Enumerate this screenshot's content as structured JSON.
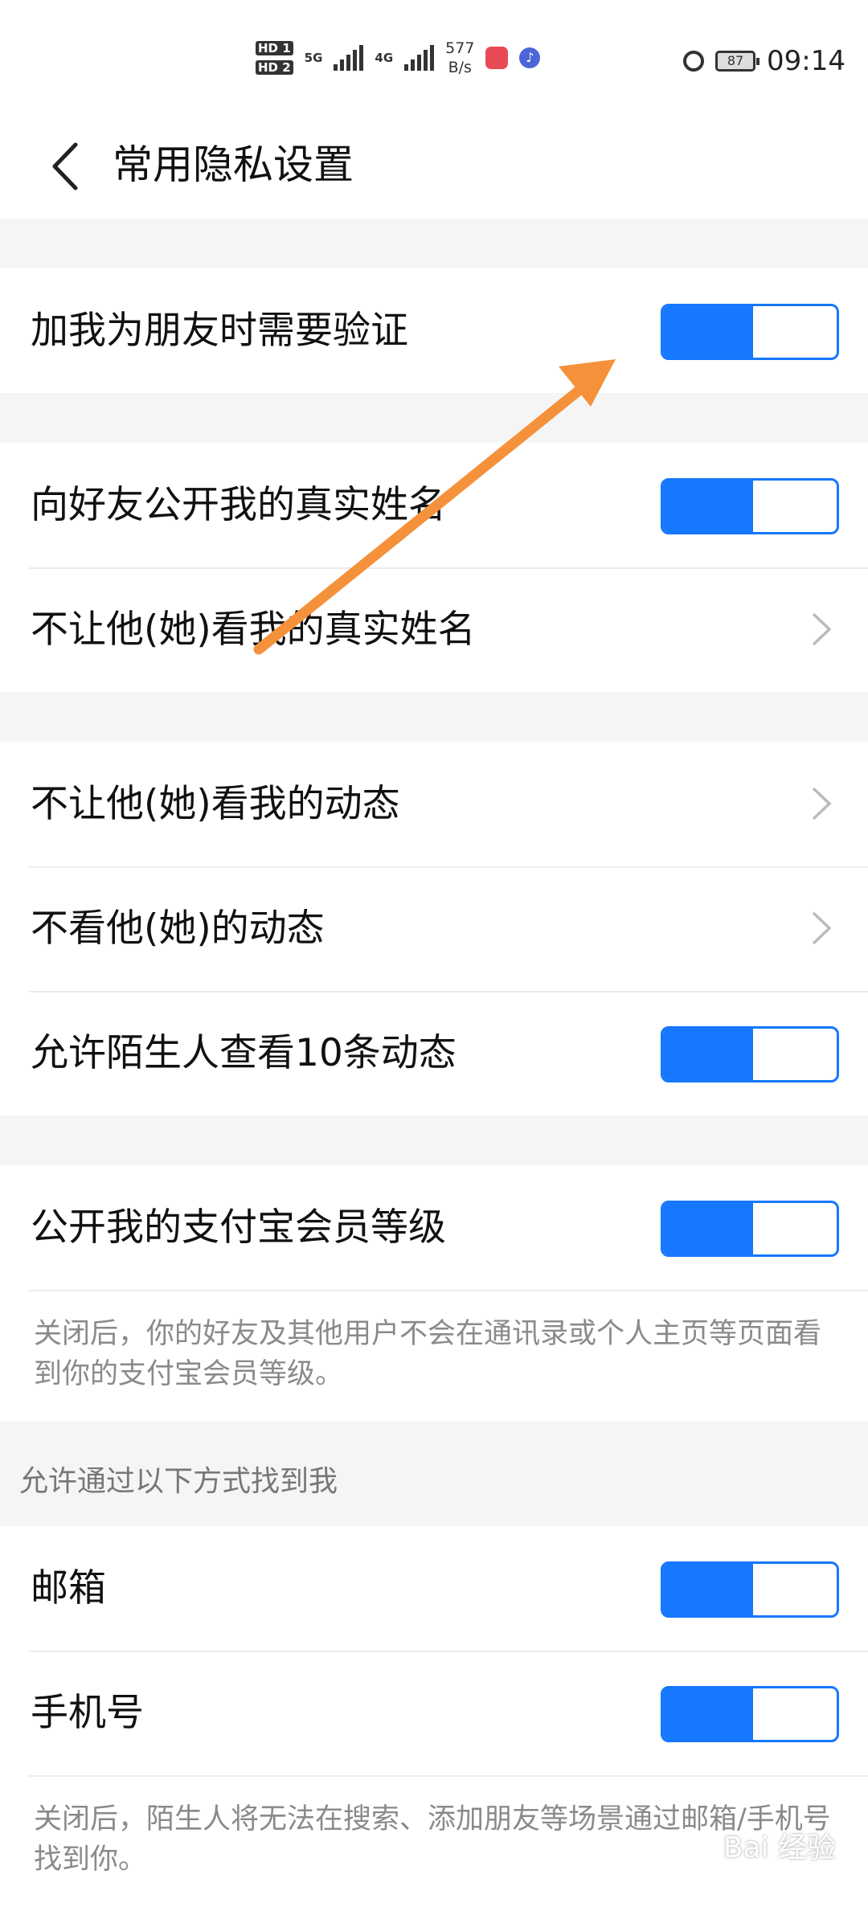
{
  "status": {
    "hd1": "HD 1",
    "hd2": "HD 2",
    "net1": "5G",
    "net2": "4G",
    "speed_value": "577",
    "speed_unit": "B/s",
    "app2_glyph": "♪",
    "battery": "87",
    "time": "09:14"
  },
  "header": {
    "title": "常用隐私设置",
    "back_icon": "chevron-left-icon"
  },
  "groups": [
    {
      "rows": [
        {
          "label": "加我为朋友时需要验证",
          "type": "toggle",
          "value": true
        }
      ]
    },
    {
      "rows": [
        {
          "label": "向好友公开我的真实姓名",
          "type": "toggle",
          "value": true
        },
        {
          "label": "不让他(她)看我的真实姓名",
          "type": "link"
        }
      ]
    },
    {
      "rows": [
        {
          "label": "不让他(她)看我的动态",
          "type": "link"
        },
        {
          "label": "不看他(她)的动态",
          "type": "link"
        },
        {
          "label": "允许陌生人查看10条动态",
          "type": "toggle",
          "value": true
        }
      ]
    },
    {
      "rows": [
        {
          "label": "公开我的支付宝会员等级",
          "type": "toggle",
          "value": true
        }
      ],
      "note": "关闭后，你的好友及其他用户不会在通讯录或个人主页等页面看到你的支付宝会员等级。"
    }
  ],
  "find_me": {
    "section_label": "允许通过以下方式找到我",
    "rows": [
      {
        "label": "邮箱",
        "type": "toggle",
        "value": true
      },
      {
        "label": "手机号",
        "type": "toggle",
        "value": true
      }
    ],
    "note": "关闭后，陌生人将无法在搜索、添加朋友等场景通过邮箱/手机号找到你。"
  },
  "watermark": "Bai 经验",
  "colors": {
    "accent": "#1677ff",
    "annotation_arrow": "#f5913a",
    "background": "#f5f5f5"
  }
}
